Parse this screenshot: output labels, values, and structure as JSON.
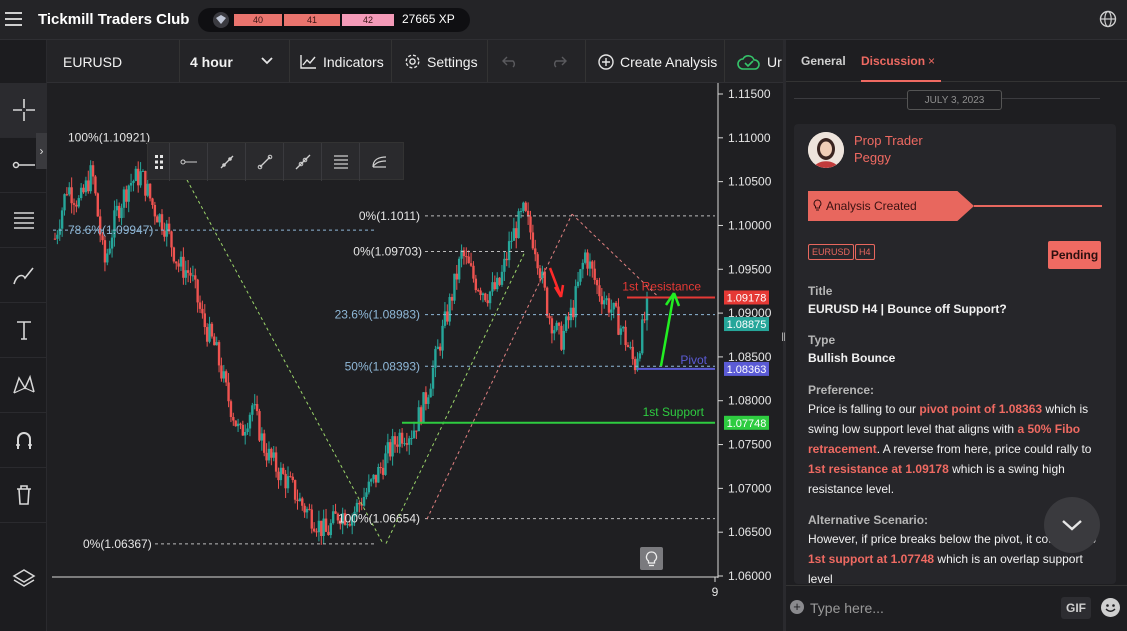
{
  "app": {
    "title": "Tickmill Traders Club"
  },
  "xp": {
    "levels": [
      "40",
      "41",
      "42"
    ],
    "progress_fraction": [
      1,
      1,
      0.92
    ],
    "total": "27665 XP"
  },
  "toolbar": {
    "symbol": "EURUSD",
    "timeframe": "4 hour",
    "indicators": "Indicators",
    "settings": "Settings",
    "create_analysis": "Create Analysis",
    "cut_label": "Ur"
  },
  "left_tools": [
    "crosshair-icon",
    "horizontal-ray-icon",
    "fib-lines-icon",
    "brush-icon",
    "text-icon",
    "pattern-icon",
    "magnet-icon",
    "trash-icon",
    "layers-icon"
  ],
  "float_tools": [
    "ray-icon",
    "segment-icon",
    "line-icon",
    "extended-line-icon",
    "fib-retracement-icon",
    "fib-fan-icon"
  ],
  "chart_data": {
    "type": "candlestick",
    "symbol": "EURUSD",
    "timeframe": "4 hour",
    "ylim": [
      1.06,
      1.115
    ],
    "y_ticks": [
      "1.11500",
      "1.11000",
      "1.10500",
      "1.10000",
      "1.09500",
      "1.09000",
      "1.08500",
      "1.08000",
      "1.07500",
      "1.07000",
      "1.06500",
      "1.06000"
    ],
    "x_tick": "9",
    "close_path": [
      1.0985,
      1.1045,
      1.1025,
      1.1062,
      1.0955,
      1.1015,
      1.1048,
      1.1058,
      1.102,
      1.0998,
      1.0955,
      1.0945,
      1.089,
      1.086,
      1.0805,
      1.076,
      1.0795,
      1.0745,
      1.0722,
      1.0705,
      1.0682,
      1.0665,
      1.0648,
      1.0672,
      1.0668,
      1.069,
      1.0712,
      1.074,
      1.0762,
      1.0765,
      1.08,
      1.0855,
      1.091,
      1.0968,
      1.0938,
      1.0922,
      1.093,
      1.0985,
      1.1015,
      1.0975,
      1.09,
      1.0868,
      1.0905,
      1.0968,
      1.0928,
      1.0908,
      1.088,
      1.084,
      1.0905
    ],
    "fib_left": [
      {
        "label": "100%(1.10921)",
        "value": 1.10921
      },
      {
        "label": "78.6%(1.09947)",
        "value": 1.09947
      },
      {
        "label": "0%(1.06367)",
        "value": 1.06367
      }
    ],
    "fib_right": [
      {
        "label": "0%(1.1011)",
        "value": 1.1011
      },
      {
        "label": "0%(1.09703)",
        "value": 1.09703
      },
      {
        "label": "23.6%(1.08983)",
        "value": 1.08983
      },
      {
        "label": "50%(1.08393)",
        "value": 1.08393
      },
      {
        "label": "100%(1.06654)",
        "value": 1.06654
      }
    ],
    "levels": [
      {
        "name": "1st Resistance",
        "value": 1.09178,
        "tag": "1.09178",
        "color": "#e53935"
      },
      {
        "name": "Pivot",
        "value": 1.08363,
        "tag": "1.08363",
        "color": "#5b5bd6"
      },
      {
        "name": "1st Support",
        "value": 1.07748,
        "tag": "1.07748",
        "color": "#2ecc40"
      }
    ],
    "price_tags": [
      {
        "value": 1.08875,
        "tag": "1.08875",
        "color": "#26a69a"
      }
    ]
  },
  "panel": {
    "tabs": {
      "general": "General",
      "discussion": "Discussion"
    },
    "date": "JULY 3, 2023",
    "author_role": "Prop Trader",
    "author_name": "Peggy",
    "created": "Analysis Created",
    "tags": [
      "EURUSD",
      "H4"
    ],
    "status": "Pending",
    "title_label": "Title",
    "title_value": "EURUSD H4 | Bounce off Support?",
    "type_label": "Type",
    "type_value": "Bullish Bounce",
    "pref_label": "Preference:",
    "pref_1": "Price is falling to our ",
    "pref_2": "pivot point of 1.08363",
    "pref_3": " which is swing low support level that aligns with ",
    "pref_4": "a 50% Fibo retracement",
    "pref_5": ". A reverse from here, price could rally to ",
    "pref_6": "1st resistance at 1.09178",
    "pref_7": " which is a swing high resistance level.",
    "alt_label": "Alternative Scenario:",
    "alt_1": "However, if price breaks below the pivot, it could fall to ",
    "alt_2": "1st support at 1.07748",
    "alt_3": " which is an overlap support level",
    "input_placeholder": "Type here...",
    "gif": "GIF"
  }
}
